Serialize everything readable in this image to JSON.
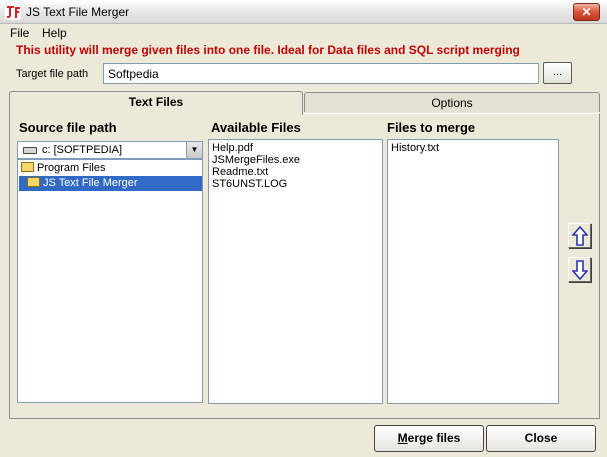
{
  "window": {
    "title": "JS Text File Merger",
    "close_glyph": "✕"
  },
  "menu": [
    "File",
    "Help"
  ],
  "banner": "This utility will merge given files into one file.  Ideal for Data files and SQL script merging",
  "target": {
    "label": "Target file path",
    "value": "Softpedia",
    "browse_label": "..."
  },
  "tabs": [
    {
      "label": "Text Files",
      "active": true
    },
    {
      "label": "Options",
      "active": false
    }
  ],
  "source": {
    "heading": "Source file path",
    "drive": "c: [SOFTPEDIA]",
    "folders": [
      {
        "label": "Program Files",
        "selected": false
      },
      {
        "label": "JS Text File Merger",
        "selected": true
      }
    ]
  },
  "available": {
    "heading": "Available Files",
    "files": [
      "Help.pdf",
      "JSMergeFiles.exe",
      "Readme.txt",
      "ST6UNST.LOG"
    ]
  },
  "merge": {
    "heading": "Files to merge",
    "files": [
      "History.txt"
    ]
  },
  "buttons": {
    "merge_prefix": "M",
    "merge_rest": "erge files",
    "close": "Close"
  },
  "icons": {
    "move_up": "up-arrow-icon",
    "move_down": "down-arrow-icon",
    "app": "js-app-icon"
  },
  "colors": {
    "banner": "#c00000",
    "selection": "#316ac5",
    "arrow": "#2a35b0"
  }
}
